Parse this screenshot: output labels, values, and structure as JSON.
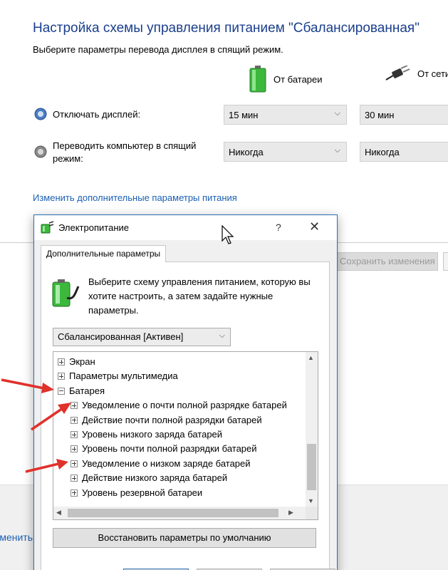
{
  "main": {
    "title": "Настройка схемы управления питанием \"Сбалансированная\"",
    "subtitle": "Выберите параметры перевода дисплея в спящий режим.",
    "col_battery": "От батареи",
    "col_plugged": "От сети",
    "rows": [
      {
        "label": "Отключать дисплей:",
        "battery_value": "15 мин",
        "plugged_value": "30 мин"
      },
      {
        "label": "Переводить компьютер в спящий режим:",
        "battery_value": "Никогда",
        "plugged_value": "Никогда"
      }
    ],
    "advanced_link": "Изменить дополнительные параметры питания",
    "save_button": "Сохранить изменения",
    "footer_link": "Отменить"
  },
  "dialog": {
    "title": "Электропитание",
    "help": "?",
    "close": "✕",
    "tab": "Дополнительные параметры",
    "intro": "Выберите схему управления питанием, которую вы хотите настроить, а затем задайте нужные параметры.",
    "scheme": "Сбалансированная [Активен]",
    "tree": [
      {
        "label": "Экран",
        "level": 0,
        "expanded": false
      },
      {
        "label": "Параметры мультимедиа",
        "level": 0,
        "expanded": false
      },
      {
        "label": "Батарея",
        "level": 0,
        "expanded": true
      },
      {
        "label": "Уведомление о почти полной разрядке батарей",
        "level": 1,
        "expanded": false
      },
      {
        "label": "Действие почти полной разрядки батарей",
        "level": 1,
        "expanded": false
      },
      {
        "label": "Уровень низкого заряда батарей",
        "level": 1,
        "expanded": false
      },
      {
        "label": "Уровень почти полной разрядки батарей",
        "level": 1,
        "expanded": false
      },
      {
        "label": "Уведомление о низком заряде батарей",
        "level": 1,
        "expanded": false
      },
      {
        "label": "Действие низкого заряда батарей",
        "level": 1,
        "expanded": false
      },
      {
        "label": "Уровень резервной батареи",
        "level": 1,
        "expanded": false
      }
    ],
    "restore_button": "Восстановить параметры по умолчанию"
  },
  "colors": {
    "accent_blue": "#1a3e8c",
    "link_blue": "#1a5fb4",
    "dialog_border": "#2b6fb3",
    "arrow_red": "#e0312b"
  }
}
